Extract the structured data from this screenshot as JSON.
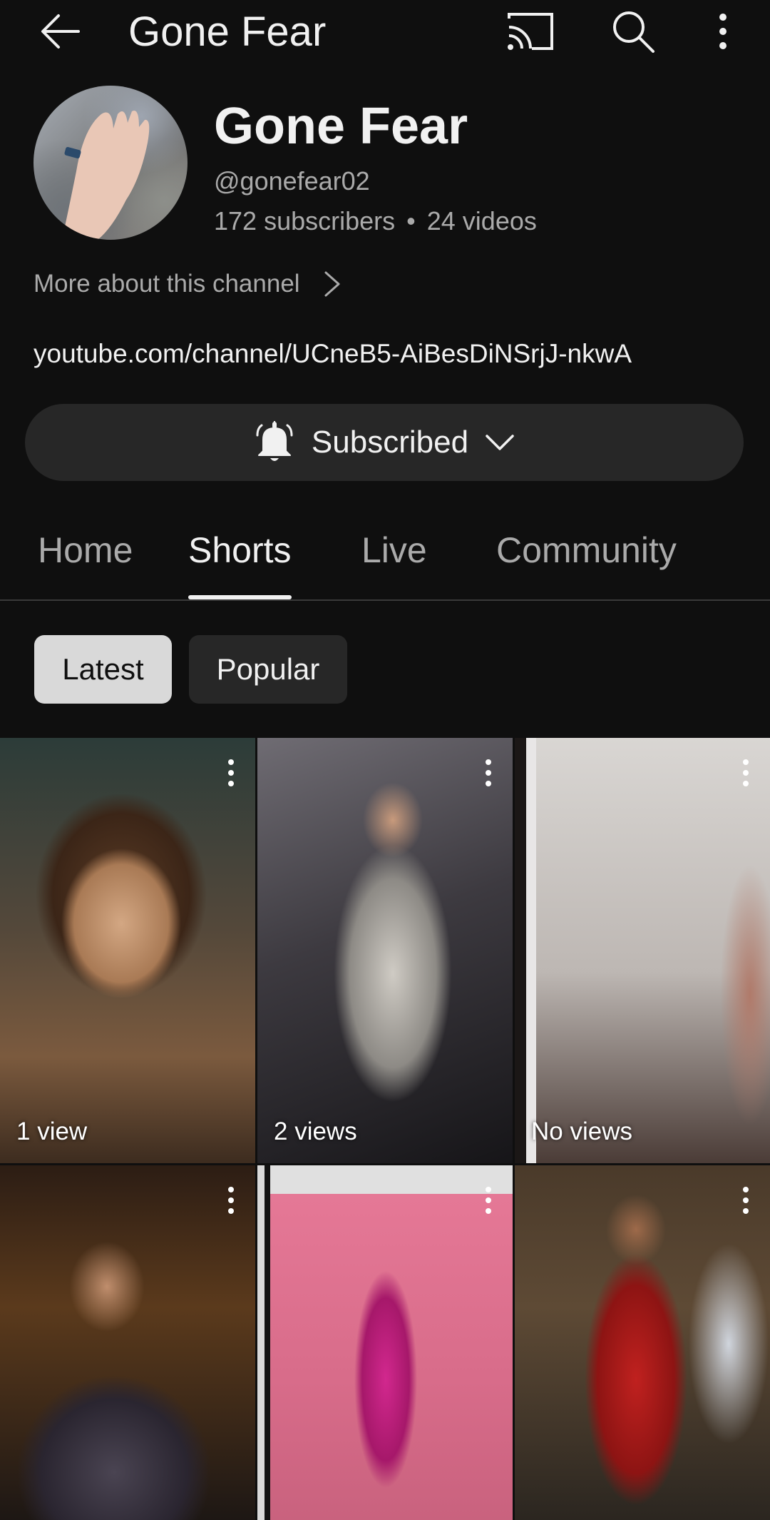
{
  "app_bar": {
    "title": "Gone Fear",
    "icons": [
      "back-arrow-icon",
      "cast-icon",
      "search-icon",
      "more-vert-icon"
    ]
  },
  "channel": {
    "name": "Gone Fear",
    "handle": "@gonefear02",
    "subscribers": "172 subscribers",
    "separator": "•",
    "videos": "24 videos",
    "more_about": "More about this channel",
    "link": "youtube.com/channel/UCneB5-AiBesDiNSrjJ-nkwA"
  },
  "subscribe_button": {
    "label": "Subscribed",
    "icon": "bell-icon"
  },
  "tabs": [
    {
      "label": "Home",
      "active": false
    },
    {
      "label": "Shorts",
      "active": true
    },
    {
      "label": "Live",
      "active": false
    },
    {
      "label": "Community",
      "active": false
    }
  ],
  "filters": [
    {
      "label": "Latest",
      "selected": true
    },
    {
      "label": "Popular",
      "selected": false
    }
  ],
  "shorts": [
    {
      "views": "1 view"
    },
    {
      "views": "2 views"
    },
    {
      "views": "No views"
    },
    {
      "views": ""
    },
    {
      "views": ""
    },
    {
      "views": ""
    }
  ],
  "colors": {
    "background": "#0f0f0f",
    "surface": "#272727",
    "text_primary": "#f1f1f1",
    "text_secondary": "#aaaaaa",
    "chip_selected": "#d9d9d9"
  }
}
